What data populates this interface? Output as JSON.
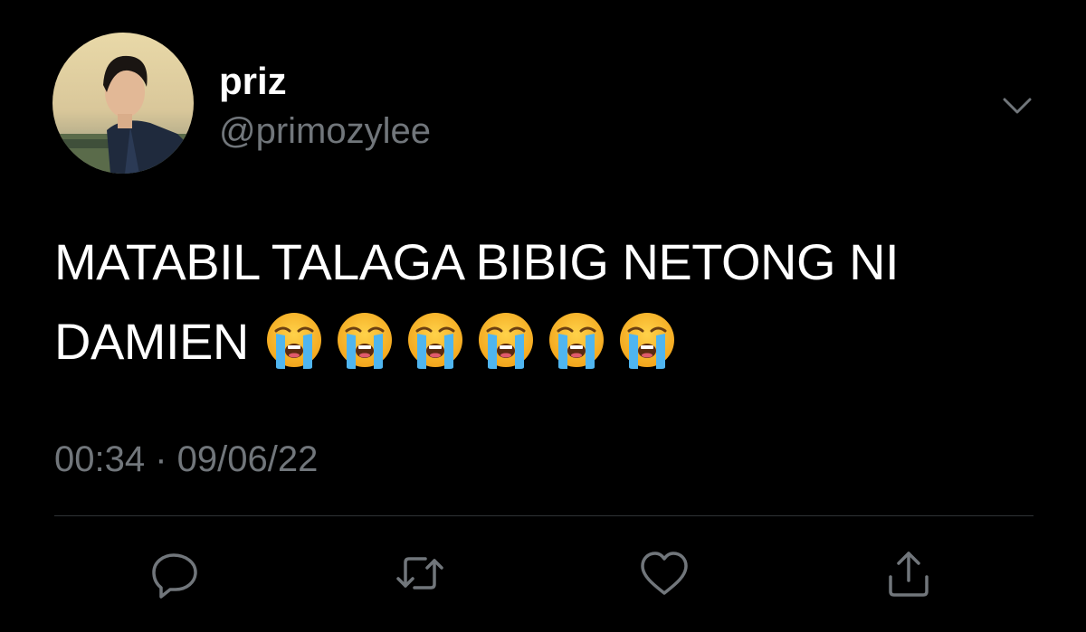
{
  "colors": {
    "background": "#000000",
    "primary_text": "#ffffff",
    "secondary_text": "#71767b",
    "divider": "#2f3336",
    "icon": "#71767b"
  },
  "author": {
    "display_name": "priz",
    "handle": "@primozylee"
  },
  "tweet": {
    "text_line1": "MATABIL TALAGA BIBIG NETONG NI",
    "text_line2": "DAMIEN",
    "emojis": [
      "loudly-crying-face",
      "loudly-crying-face",
      "loudly-crying-face",
      "loudly-crying-face",
      "loudly-crying-face",
      "loudly-crying-face"
    ],
    "timestamp": "00:34 · 09/06/22"
  },
  "actions": {
    "reply_icon": "speech-bubble-icon",
    "retweet_icon": "retweet-icon",
    "like_icon": "heart-icon",
    "share_icon": "share-icon"
  },
  "menu": {
    "caret_icon": "chevron-down-icon"
  }
}
